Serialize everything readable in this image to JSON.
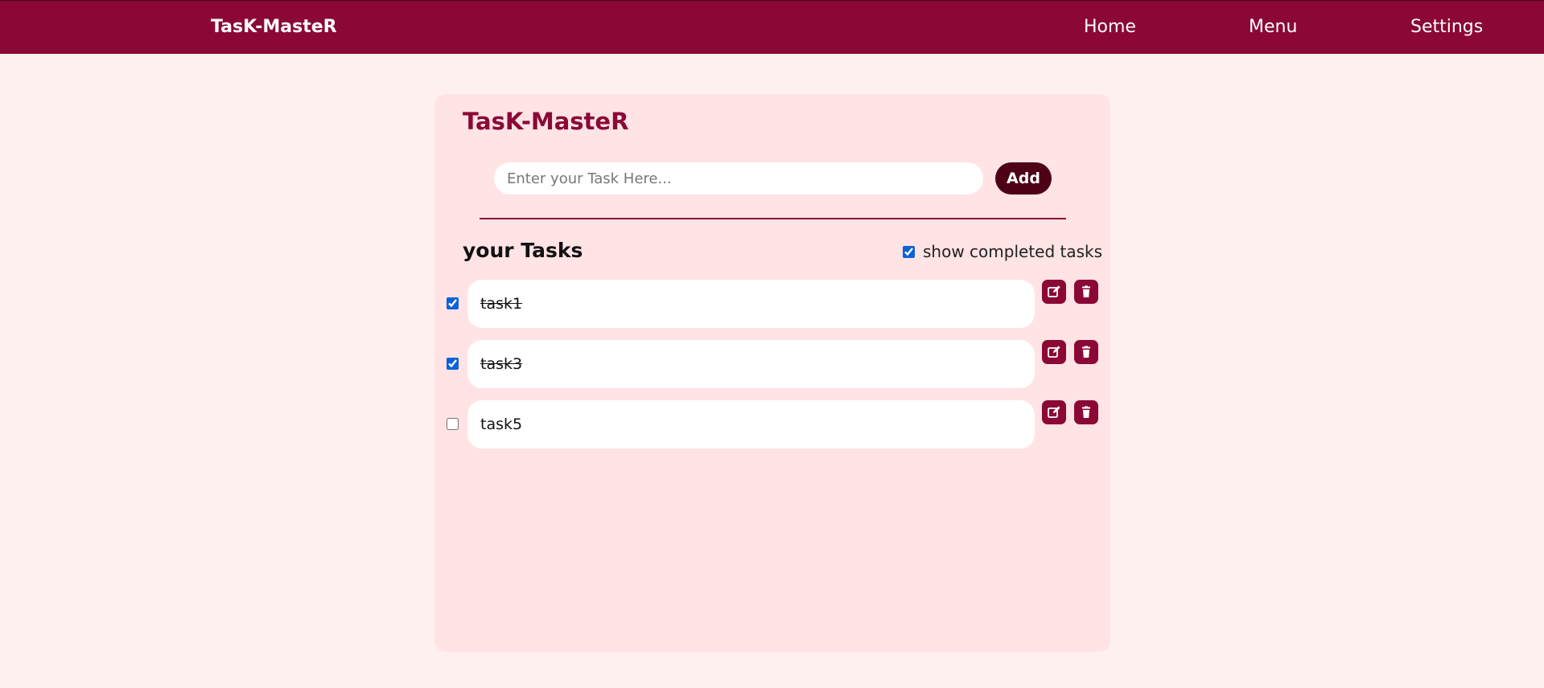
{
  "navbar": {
    "brand": "TasK-MasteR",
    "links": [
      "Home",
      "Menu",
      "Settings"
    ]
  },
  "card": {
    "title": "TasK-MasteR",
    "input": {
      "placeholder": "Enter your Task Here...",
      "value": ""
    },
    "add_label": "Add",
    "tasks_heading": "your Tasks",
    "show_completed": {
      "label": "show completed tasks",
      "checked": true
    },
    "tasks": [
      {
        "text": "task1",
        "completed": true
      },
      {
        "text": "task3",
        "completed": true
      },
      {
        "text": "task5",
        "completed": false
      }
    ]
  },
  "icons": {
    "edit": "edit-icon",
    "delete": "trash-icon"
  },
  "colors": {
    "primary": "#8b0836",
    "add_button": "#4e0017",
    "background": "#fff0f0",
    "card": "#ffe3e5",
    "checkbox": "#0b62d6"
  }
}
